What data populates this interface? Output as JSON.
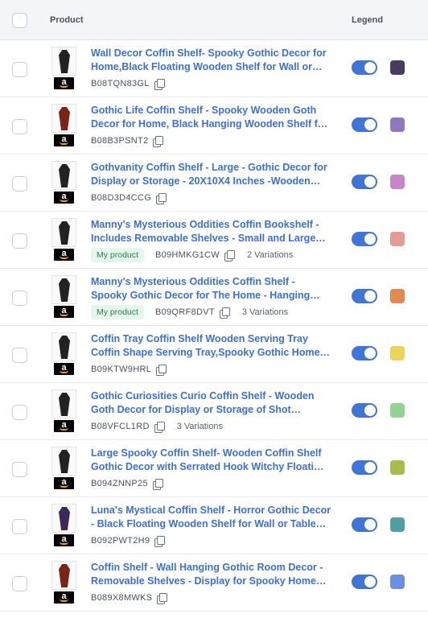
{
  "header": {
    "product_label": "Product",
    "legend_label": "Legend"
  },
  "rows": [
    {
      "title": "Wall Decor Coffin Shelf- Spooky Gothic Decor for Home,Black Floating Wooden Shelf for Wall or…",
      "asin": "B08TQN83GL",
      "badge": "",
      "variations": "",
      "color": "#4a3b63",
      "thumb": "black",
      "enabled": true
    },
    {
      "title": "Gothic Life Coffin Shelf - Spooky Wooden Goth Decor for Home, Black Hanging Wooden Shelf f…",
      "asin": "B08B3PSNT2",
      "badge": "",
      "variations": "",
      "color": "#8e78c2",
      "thumb": "red",
      "enabled": true
    },
    {
      "title": "Gothvanity Coffin Shelf - Large - Gothic Decor for Display or Storage - 20X10X4 Inches -Wooden…",
      "asin": "B08D3D4CCG",
      "badge": "",
      "variations": "",
      "color": "#c786c9",
      "thumb": "black",
      "enabled": true
    },
    {
      "title": "Manny's Mysterious Oddities Coffin Bookshelf - Includes Removable Shelves - Small and Large…",
      "asin": "B09HMKG1CW",
      "badge": "My product",
      "variations": "2 Variations",
      "color": "#e79a95",
      "thumb": "black",
      "enabled": true
    },
    {
      "title": "Manny's Mysterious Oddities Coffin Shelf - Spooky Gothic Decor for The Home - Hanging…",
      "asin": "B09QRF8DVT",
      "badge": "My product",
      "variations": "3 Variations",
      "color": "#e38a4e",
      "thumb": "black",
      "enabled": true
    },
    {
      "title": "Coffin Tray Coffin Shelf Wooden Serving Tray Coffin Shape Serving Tray,Spooky Gothic Home…",
      "asin": "B09KTW9HRL",
      "badge": "",
      "variations": "",
      "color": "#ecd35a",
      "thumb": "black",
      "enabled": true
    },
    {
      "title": "Gothic Curiosities Curio Coffin Shelf - Wooden Goth Decor for Display or Storage of Shot…",
      "asin": "B08VFCL1RD",
      "badge": "",
      "variations": "3 Variations",
      "color": "#93d393",
      "thumb": "black",
      "enabled": true
    },
    {
      "title": "Large Spooky Coffin Shelf- Wooden Coffin Shelf Gothic Decor with Serrated Hook Witchy Floati…",
      "asin": "B094ZNNP25",
      "badge": "",
      "variations": "",
      "color": "#a8bd49",
      "thumb": "black",
      "enabled": true
    },
    {
      "title": "Luna's Mystical Coffin Shelf - Horror Gothic Decor - Black Floating Wooden Shelf for Wall or Table…",
      "asin": "B092PWT2H9",
      "badge": "",
      "variations": "",
      "color": "#4f9ea6",
      "thumb": "violet",
      "enabled": true
    },
    {
      "title": "Coffin Shelf - Wall Hanging Gothic Room Decor - Removable Shelves - Display for Spooky Home…",
      "asin": "B089X8MWKS",
      "badge": "",
      "variations": "",
      "color": "#6b8fe3",
      "thumb": "red",
      "enabled": true
    }
  ],
  "icons": {
    "copy": "copy-icon",
    "brand": "amazon-logo-icon"
  }
}
